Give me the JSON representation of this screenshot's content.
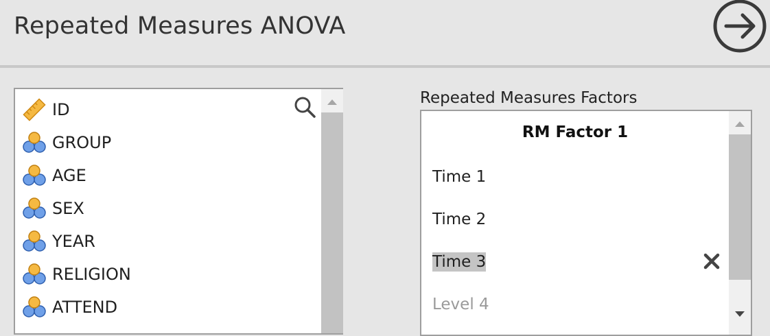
{
  "header": {
    "title": "Repeated Measures ANOVA",
    "go_icon": "arrow-right-circle-icon"
  },
  "variables": {
    "items": [
      {
        "label": "ID",
        "icon": "ruler-icon"
      },
      {
        "label": "GROUP",
        "icon": "nominal-icon"
      },
      {
        "label": "AGE",
        "icon": "nominal-icon"
      },
      {
        "label": "SEX",
        "icon": "nominal-icon"
      },
      {
        "label": "YEAR",
        "icon": "nominal-icon"
      },
      {
        "label": "RELIGION",
        "icon": "nominal-icon"
      },
      {
        "label": "ATTEND",
        "icon": "nominal-icon"
      }
    ],
    "search_icon": "search-icon"
  },
  "rm_factors": {
    "label": "Repeated Measures Factors",
    "factor_name": "RM Factor 1",
    "levels": [
      "Time 1",
      "Time 2",
      "Time 3"
    ],
    "selected_level": "Time 3",
    "placeholder_level": "Level 4",
    "delete_icon": "close-icon"
  },
  "colors": {
    "ruler": "#f0a830",
    "nominal_top": "#f5b942",
    "nominal_bottom": "#6fa0e8"
  }
}
